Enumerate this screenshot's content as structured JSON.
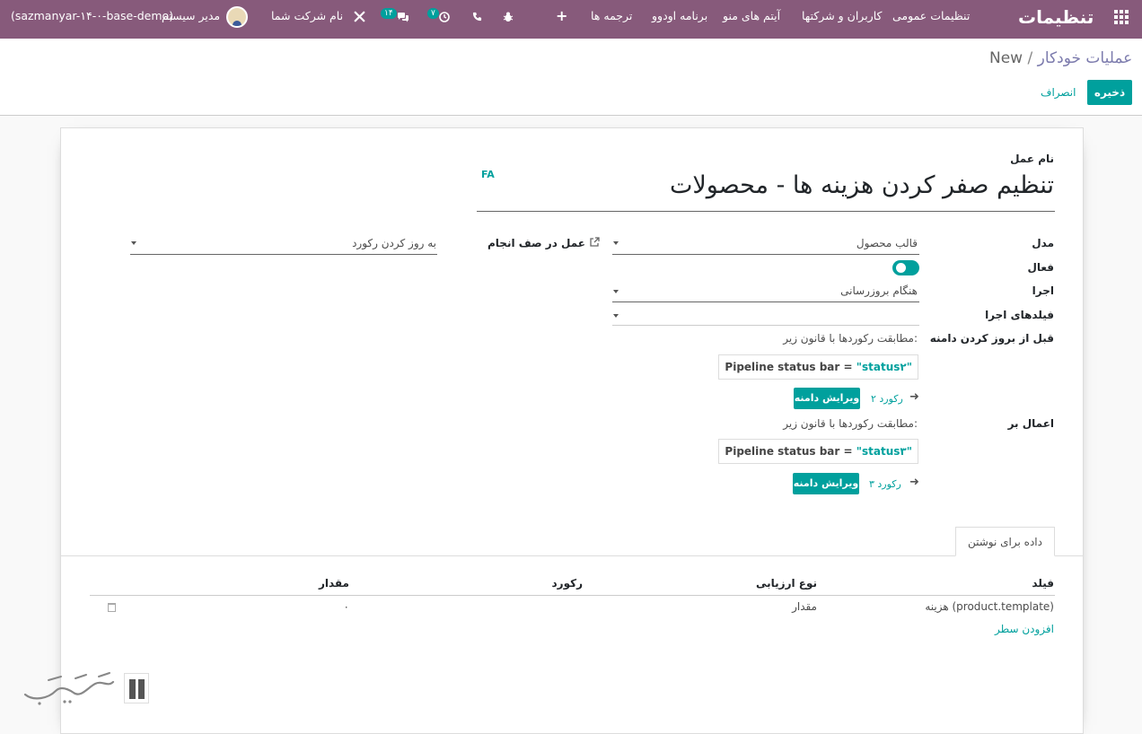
{
  "navbar": {
    "brand": "تنظیمات",
    "menu": [
      "تنظیمات عمومی",
      "کاربران و شرکتها",
      "آیتم های منو",
      "برنامه اودوو",
      "ترجمه ها"
    ],
    "messages_badge": "۱۴",
    "activities_badge": "۷",
    "company": "نام شرکت شما",
    "user": "مدیر سیستم",
    "database": "(sazmanyar-۱۴-۰-base-demo)"
  },
  "breadcrumb": {
    "parent": "عملیات خودکار",
    "separator": "/",
    "current": "New"
  },
  "buttons": {
    "save": "ذخیره",
    "discard": "انصراف"
  },
  "form": {
    "name_label": "نام عمل",
    "lang_tag": "FA",
    "name_value": "تنظیم صفر کردن هزینه ها - محصولات",
    "model_label": "مدل",
    "model_value": "قالب محصول",
    "action_label": "عمل در صف انجام",
    "action_value": "به روز کردن رکورد",
    "active_label": "فعال",
    "active_value": true,
    "trigger_label": "اجرا",
    "trigger_value": "هنگام بروزرسانی",
    "trigger_fields_label": "فیلدهای اجرا",
    "trigger_fields_value": "",
    "before_domain_label": "قبل از بروز کردن دامنه",
    "before_domain_desc": "مطابقت رکوردها با قانون زیر:",
    "before_domain_field": "Pipeline status bar",
    "before_domain_op": "=",
    "before_domain_value": "\"status۲\"",
    "before_domain_count": "۲ رکورد",
    "edit_domain": "ویرایش دامنه",
    "apply_on_label": "اعمال بر",
    "apply_on_desc": "مطابقت رکوردها با قانون زیر:",
    "apply_on_field": "Pipeline status bar",
    "apply_on_op": "=",
    "apply_on_value": "\"status۳\"",
    "apply_on_count": "۳ رکورد"
  },
  "tab": {
    "label": "داده برای نوشتن"
  },
  "table": {
    "headers": {
      "field": "فیلد",
      "eval_type": "نوع ارزیابی",
      "record": "رکورد",
      "value": "مقدار"
    },
    "rows": [
      {
        "field": "هزینه (product.template)",
        "eval_type": "مقدار",
        "record": "",
        "value": "۰"
      }
    ],
    "add_line": "افزودن سطر"
  },
  "watermark": {
    "text": "تسهیل‌گستر"
  },
  "colors": {
    "navbar": "#875a7b",
    "accent": "#00a09d"
  }
}
